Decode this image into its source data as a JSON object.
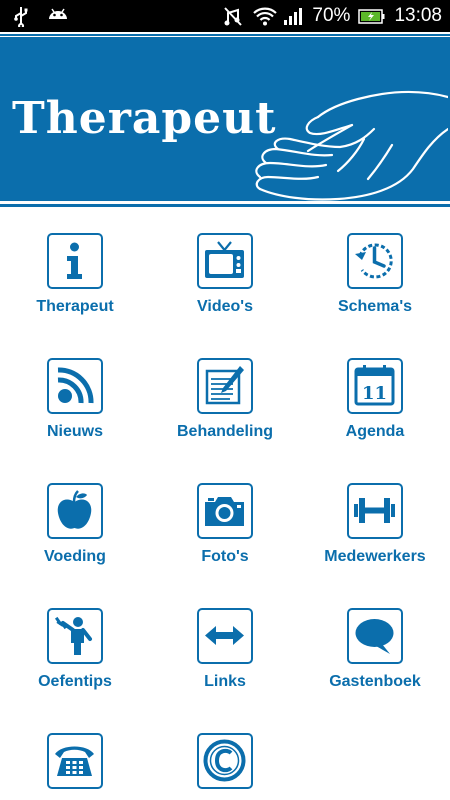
{
  "status_bar": {
    "battery": "70%",
    "time": "13:08",
    "icons": [
      "usb-icon",
      "android-icon",
      "mute-icon",
      "wifi-icon",
      "signal-icon",
      "battery-charging-icon"
    ]
  },
  "header": {
    "title": "Therapeut",
    "background_color": "#0b6eac",
    "illustration": "hand-icon"
  },
  "accent_color": "#0b6eac",
  "menu": [
    {
      "label": "Therapeut",
      "icon": "info-icon"
    },
    {
      "label": "Video's",
      "icon": "tv-icon"
    },
    {
      "label": "Schema's",
      "icon": "clock-icon"
    },
    {
      "label": "Nieuws",
      "icon": "rss-icon"
    },
    {
      "label": "Behandeling",
      "icon": "notepad-icon"
    },
    {
      "label": "Agenda",
      "icon": "calendar-icon",
      "icon_text": "11"
    },
    {
      "label": "Voeding",
      "icon": "apple-icon"
    },
    {
      "label": "Foto's",
      "icon": "camera-icon"
    },
    {
      "label": "Medewerkers",
      "icon": "dumbbell-icon"
    },
    {
      "label": "Oefentips",
      "icon": "exercise-icon"
    },
    {
      "label": "Links",
      "icon": "arrows-icon"
    },
    {
      "label": "Gastenboek",
      "icon": "speech-bubble-icon"
    },
    {
      "label": "",
      "icon": "telephone-icon"
    },
    {
      "label": "",
      "icon": "copyright-icon"
    }
  ]
}
